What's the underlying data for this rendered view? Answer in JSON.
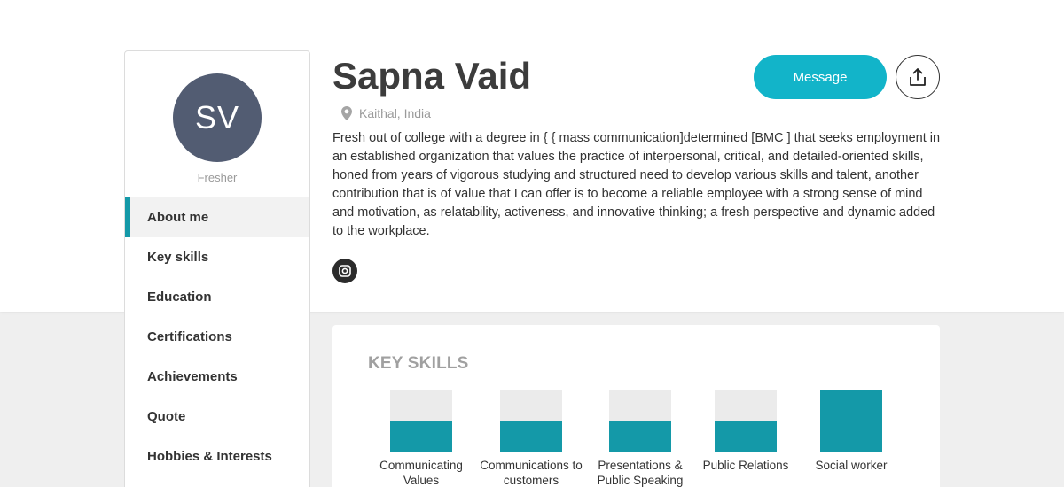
{
  "profile": {
    "initials": "SV",
    "role": "Fresher",
    "name": "Sapna Vaid",
    "location": "Kaithal, India",
    "bio": "Fresh out of college with a degree in { { mass communication]determined [BMC ] that seeks employment in an established organization that values the practice of interpersonal, critical, and detailed-oriented skills, honed from years of vigorous studying and structured need to develop various skills and talent, another contribution that is of value that I can offer is to become a reliable employee with a strong sense of mind and motivation, as relatability, activeness, and innovative thinking; a fresh perspective and dynamic added to the workplace."
  },
  "actions": {
    "message_label": "Message"
  },
  "nav": {
    "items": [
      {
        "label": "About me",
        "active": true
      },
      {
        "label": "Key skills",
        "active": false
      },
      {
        "label": "Education",
        "active": false
      },
      {
        "label": "Certifications",
        "active": false
      },
      {
        "label": "Achievements",
        "active": false
      },
      {
        "label": "Quote",
        "active": false
      },
      {
        "label": "Hobbies & Interests",
        "active": false
      }
    ]
  },
  "key_skills": {
    "title": "KEY SKILLS",
    "items": [
      {
        "label": "Communicating Values",
        "level": 0.5
      },
      {
        "label": "Communications to customers",
        "level": 0.5
      },
      {
        "label": "Presentations & Public Speaking",
        "level": 0.5
      },
      {
        "label": "Public Relations",
        "level": 0.5
      },
      {
        "label": "Social worker",
        "level": 1.0
      }
    ]
  },
  "icons": [
    "location-pin-icon",
    "instagram-icon",
    "share-icon"
  ],
  "colors": {
    "accent": "#1499a8",
    "button": "#12b4c9",
    "avatar": "#525c72"
  }
}
